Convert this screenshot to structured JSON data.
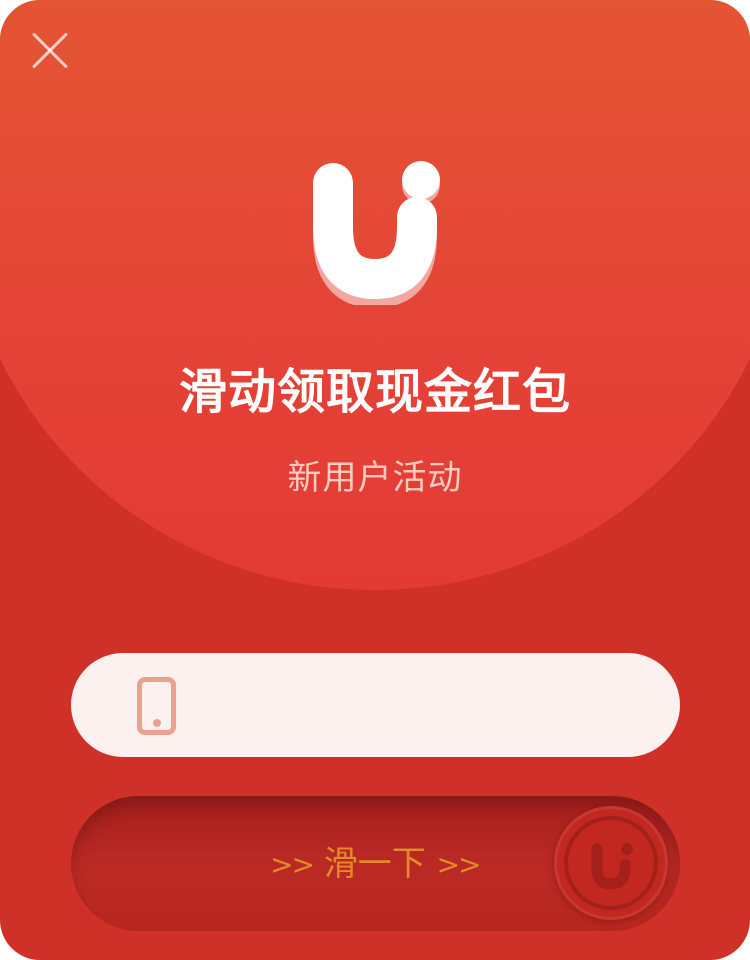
{
  "dialog": {
    "close_icon": "close-icon",
    "logo_icon": "u-logo-icon",
    "title": "滑动领取现金红包",
    "subtitle": "新用户活动"
  },
  "phone_input": {
    "icon": "phone-icon",
    "value": "",
    "placeholder": ""
  },
  "slider": {
    "left_arrows": ">>",
    "label": "滑一下",
    "right_arrows": ">>",
    "knob_icon": "u-logo-icon"
  },
  "colors": {
    "background_red": "#cf3028",
    "top_gradient_start": "#e36131",
    "top_gradient_end": "#e33b34",
    "input_background": "#fcf1ef",
    "slider_text": "#e08a28"
  }
}
